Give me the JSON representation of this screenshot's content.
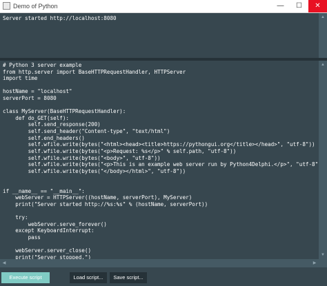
{
  "window": {
    "title": "Demo of Python",
    "icon": "app-window-icon",
    "controls": {
      "minimize": "—",
      "maximize": "☐",
      "close": "✕"
    }
  },
  "output": {
    "text": "Server started http://localhost:8080"
  },
  "editor": {
    "lines": [
      "# Python 3 server example",
      "from http.server import BaseHTTPRequestHandler, HTTPServer",
      "import time",
      "",
      "hostName = \"localhost\"",
      "serverPort = 8080",
      "",
      "class MyServer(BaseHTTPRequestHandler):",
      "    def do_GET(self):",
      "        self.send_response(200)",
      "        self.send_header(\"Content-type\", \"text/html\")",
      "        self.end_headers()",
      "        self.wfile.write(bytes(\"<html><head><title>https://pythongui.org</title></head>\", \"utf-8\"))",
      "        self.wfile.write(bytes(\"<p>Request: %s</p>\" % self.path, \"utf-8\"))",
      "        self.wfile.write(bytes(\"<body>\", \"utf-8\"))",
      "        self.wfile.write(bytes(\"<p>This is an example web server run by Python4Delphi.</p>\", \"utf-8\"))",
      "        self.wfile.write(bytes(\"</body></html>\", \"utf-8\"))",
      "",
      "",
      "if __name__ == \"__main__\":",
      "    webServer = HTTPServer((hostName, serverPort), MyServer)",
      "    print(\"Server started http://%s:%s\" % (hostName, serverPort))",
      "",
      "    try:",
      "        webServer.serve_forever()",
      "    except KeyboardInterrupt:",
      "        pass",
      "",
      "    webServer.server_close()",
      "    print(\"Server stopped.\")"
    ]
  },
  "buttons": {
    "execute": "Execute script",
    "load": "Load script...",
    "save": "Save script..."
  },
  "colors": {
    "background": "#37474f",
    "accent": "#80cbc4",
    "dark_button": "#263238",
    "close": "#e81123"
  }
}
